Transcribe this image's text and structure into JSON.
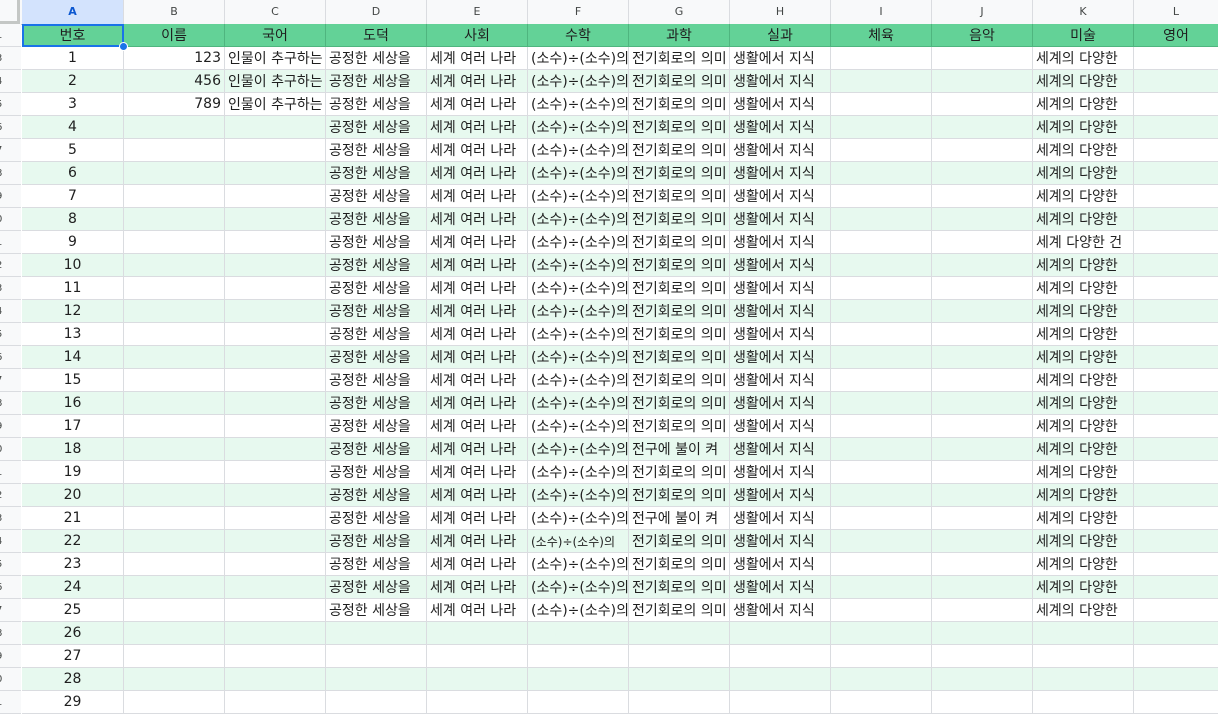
{
  "columns": [
    "A",
    "B",
    "C",
    "D",
    "E",
    "F",
    "G",
    "H",
    "I",
    "J",
    "K",
    "L"
  ],
  "row_numbers": [
    "1",
    "3",
    "4",
    "5",
    "6",
    "7",
    "8",
    "9",
    "0",
    "1",
    "2",
    "3",
    "4",
    "5",
    "6",
    "7",
    "8",
    "9",
    "0",
    "1",
    "2",
    "3",
    "4",
    "5",
    "6",
    "7",
    "8",
    "9",
    "0",
    "1"
  ],
  "header": [
    "번호",
    "이름",
    "국어",
    "도덕",
    "사회",
    "수학",
    "과학",
    "실과",
    "체육",
    "음악",
    "미술",
    "영어"
  ],
  "rows": [
    [
      "1",
      "123",
      "인물이 추구하는",
      "공정한 세상을",
      "세계 여러 나라",
      "(소수)÷(소수)의",
      "전기회로의 의미",
      "생활에서 지식",
      "",
      "",
      "세계의 다양한",
      ""
    ],
    [
      "2",
      "456",
      "인물이 추구하는",
      "공정한 세상을",
      "세계 여러 나라",
      "(소수)÷(소수)의",
      "전기회로의 의미",
      "생활에서 지식",
      "",
      "",
      "세계의 다양한",
      ""
    ],
    [
      "3",
      "789",
      "인물이 추구하는",
      "공정한 세상을",
      "세계 여러 나라",
      "(소수)÷(소수)의",
      "전기회로의 의미",
      "생활에서 지식",
      "",
      "",
      "세계의 다양한",
      ""
    ],
    [
      "4",
      "",
      "",
      "공정한 세상을",
      "세계 여러 나라",
      "(소수)÷(소수)의",
      "전기회로의 의미",
      "생활에서 지식",
      "",
      "",
      "세계의 다양한",
      ""
    ],
    [
      "5",
      "",
      "",
      "공정한 세상을",
      "세계 여러 나라",
      "(소수)÷(소수)의",
      "전기회로의 의미",
      "생활에서 지식",
      "",
      "",
      "세계의 다양한",
      ""
    ],
    [
      "6",
      "",
      "",
      "공정한 세상을",
      "세계 여러 나라",
      "(소수)÷(소수)의",
      "전기회로의 의미",
      "생활에서 지식",
      "",
      "",
      "세계의 다양한",
      ""
    ],
    [
      "7",
      "",
      "",
      "공정한 세상을",
      "세계 여러 나라",
      "(소수)÷(소수)의",
      "전기회로의 의미",
      "생활에서 지식",
      "",
      "",
      "세계의 다양한",
      ""
    ],
    [
      "8",
      "",
      "",
      "공정한 세상을",
      "세계 여러 나라",
      "(소수)÷(소수)의",
      "전기회로의 의미",
      "생활에서 지식",
      "",
      "",
      "세계의 다양한",
      ""
    ],
    [
      "9",
      "",
      "",
      "공정한 세상을",
      "세계 여러 나라",
      "(소수)÷(소수)의",
      "전기회로의 의미",
      "생활에서 지식",
      "",
      "",
      "세계 다양한 건",
      ""
    ],
    [
      "10",
      "",
      "",
      "공정한 세상을",
      "세계 여러 나라",
      "(소수)÷(소수)의",
      "전기회로의 의미",
      "생활에서 지식",
      "",
      "",
      "세계의 다양한",
      ""
    ],
    [
      "11",
      "",
      "",
      "공정한 세상을",
      "세계 여러 나라",
      "(소수)÷(소수)의",
      "전기회로의 의미",
      "생활에서 지식",
      "",
      "",
      "세계의 다양한",
      ""
    ],
    [
      "12",
      "",
      "",
      "공정한 세상을",
      "세계 여러 나라",
      "(소수)÷(소수)의",
      "전기회로의 의미",
      "생활에서 지식",
      "",
      "",
      "세계의 다양한",
      ""
    ],
    [
      "13",
      "",
      "",
      "공정한 세상을",
      "세계 여러 나라",
      "(소수)÷(소수)의",
      "전기회로의 의미",
      "생활에서 지식",
      "",
      "",
      "세계의 다양한",
      ""
    ],
    [
      "14",
      "",
      "",
      "공정한 세상을",
      "세계 여러 나라",
      "(소수)÷(소수)의",
      "전기회로의 의미",
      "생활에서 지식",
      "",
      "",
      "세계의 다양한",
      ""
    ],
    [
      "15",
      "",
      "",
      "공정한 세상을",
      "세계 여러 나라",
      "(소수)÷(소수)의",
      "전기회로의 의미",
      "생활에서 지식",
      "",
      "",
      "세계의 다양한",
      ""
    ],
    [
      "16",
      "",
      "",
      "공정한 세상을",
      "세계 여러 나라",
      "(소수)÷(소수)의",
      "전기회로의 의미",
      "생활에서 지식",
      "",
      "",
      "세계의 다양한",
      ""
    ],
    [
      "17",
      "",
      "",
      "공정한 세상을",
      "세계 여러 나라",
      "(소수)÷(소수)의",
      "전기회로의 의미",
      "생활에서 지식",
      "",
      "",
      "세계의 다양한",
      ""
    ],
    [
      "18",
      "",
      "",
      "공정한 세상을",
      "세계 여러 나라",
      "(소수)÷(소수)의",
      "전구에 불이 켜",
      "생활에서 지식",
      "",
      "",
      "세계의 다양한",
      ""
    ],
    [
      "19",
      "",
      "",
      "공정한 세상을",
      "세계 여러 나라",
      "(소수)÷(소수)의",
      "전기회로의 의미",
      "생활에서 지식",
      "",
      "",
      "세계의 다양한",
      ""
    ],
    [
      "20",
      "",
      "",
      "공정한 세상을",
      "세계 여러 나라",
      "(소수)÷(소수)의",
      "전기회로의 의미",
      "생활에서 지식",
      "",
      "",
      "세계의 다양한",
      ""
    ],
    [
      "21",
      "",
      "",
      "공정한 세상을",
      "세계 여러 나라",
      "(소수)÷(소수)의",
      "전구에 불이 켜",
      "생활에서 지식",
      "",
      "",
      "세계의 다양한",
      ""
    ],
    [
      "22",
      "",
      "",
      "공정한 세상을",
      "세계 여러 나라",
      "(소수)÷(소수)의",
      "전기회로의 의미",
      "생활에서 지식",
      "",
      "",
      "세계의 다양한",
      ""
    ],
    [
      "23",
      "",
      "",
      "공정한 세상을",
      "세계 여러 나라",
      "(소수)÷(소수)의",
      "전기회로의 의미",
      "생활에서 지식",
      "",
      "",
      "세계의 다양한",
      ""
    ],
    [
      "24",
      "",
      "",
      "공정한 세상을",
      "세계 여러 나라",
      "(소수)÷(소수)의",
      "전기회로의 의미",
      "생활에서 지식",
      "",
      "",
      "세계의 다양한",
      ""
    ],
    [
      "25",
      "",
      "",
      "공정한 세상을",
      "세계 여러 나라",
      "(소수)÷(소수)의",
      "전기회로의 의미",
      "생활에서 지식",
      "",
      "",
      "세계의 다양한",
      ""
    ],
    [
      "26",
      "",
      "",
      "",
      "",
      "",
      "",
      "",
      "",
      "",
      "",
      ""
    ],
    [
      "27",
      "",
      "",
      "",
      "",
      "",
      "",
      "",
      "",
      "",
      "",
      ""
    ],
    [
      "28",
      "",
      "",
      "",
      "",
      "",
      "",
      "",
      "",
      "",
      "",
      ""
    ],
    [
      "29",
      "",
      "",
      "",
      "",
      "",
      "",
      "",
      "",
      "",
      "",
      ""
    ]
  ],
  "selection": {
    "cell": "A1"
  },
  "colors": {
    "header_fill": "#63d297",
    "band_fill": "#e7f9ef",
    "selection": "#1a73e8"
  }
}
